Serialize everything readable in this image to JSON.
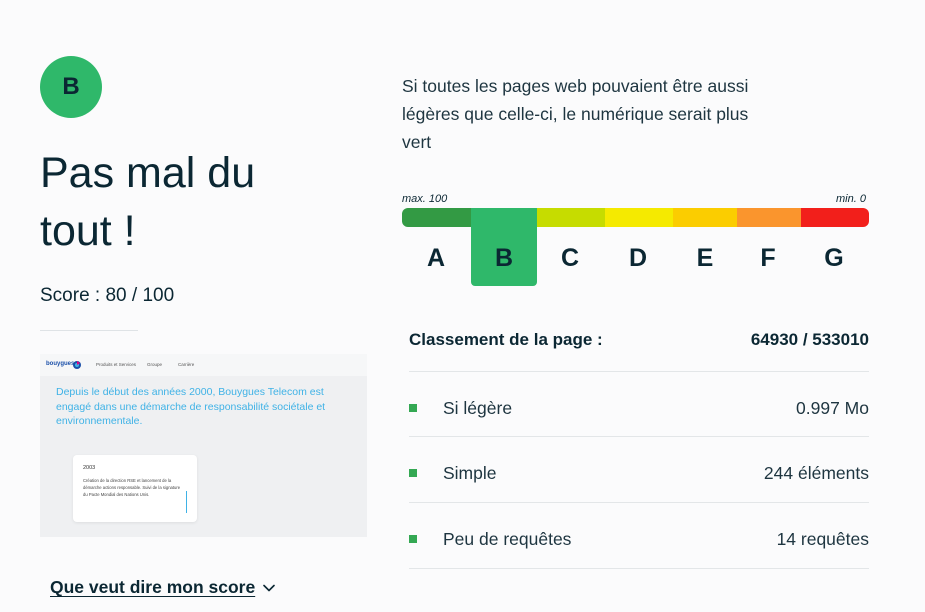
{
  "result": {
    "grade": "B",
    "headline": "Pas mal du tout !",
    "score_text": "Score : 80 / 100",
    "score_value": 80,
    "score_max": 100,
    "link_label": "Que veut dire mon score"
  },
  "thumbnail": {
    "logo_text": "bouygues",
    "nav_items": [
      "Produits et Services",
      "Groupe",
      "Carrière"
    ],
    "title": "Depuis le début des années 2000, Bouygues Telecom est engagé dans une démarche de responsabilité sociétale et environnementale.",
    "card_year": "2003",
    "card_text": "Création de la direction RSE et lancement de la démarche actions responsable. Suivi de la signature du Pacte Mondial des Nations Unis."
  },
  "intro": "Si toutes les pages web pouvaient être aussi légères que celle-ci, le numérique serait plus vert",
  "scale": {
    "max_label": "max. 100",
    "min_label": "min. 0",
    "active": "B",
    "grades": [
      {
        "letter": "A",
        "color": "#339a44"
      },
      {
        "letter": "B",
        "color": "#2fb86a"
      },
      {
        "letter": "C",
        "color": "#c6dc00"
      },
      {
        "letter": "D",
        "color": "#f5ea00"
      },
      {
        "letter": "E",
        "color": "#fbcd00"
      },
      {
        "letter": "F",
        "color": "#fa952d"
      },
      {
        "letter": "G",
        "color": "#f21f1b"
      }
    ]
  },
  "ranking": {
    "label": "Classement de la page :",
    "value": "64930 / 533010"
  },
  "metrics": [
    {
      "label": "Si légère",
      "value": "0.997 Mo"
    },
    {
      "label": "Simple",
      "value": "244 éléments"
    },
    {
      "label": "Peu de requêtes",
      "value": "14 requêtes"
    }
  ],
  "colors": {
    "accent": "#2fb86a",
    "bullet": "#34a853",
    "text": "#0b2733"
  }
}
